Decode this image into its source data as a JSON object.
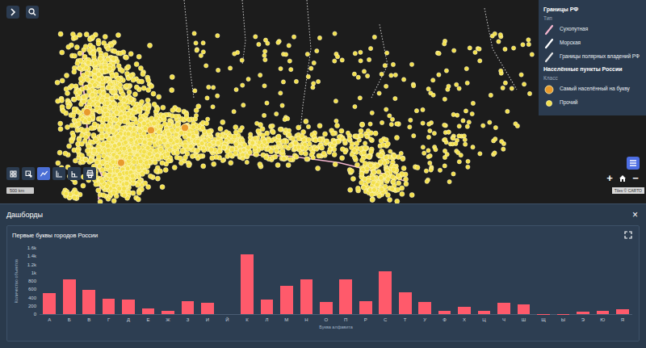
{
  "map": {
    "legend": {
      "title": "Границы РФ",
      "groups": [
        {
          "heading": "Тип",
          "items": [
            {
              "label": "Сухопутная",
              "kind": "line",
              "color": "#f4b6cf"
            },
            {
              "label": "Морская",
              "kind": "line",
              "color": "#ffffff"
            },
            {
              "label": "Границы полярных владений РФ",
              "kind": "line",
              "color": "#e6e6e6"
            }
          ]
        },
        {
          "title": "Населённые пункты России",
          "heading": "Класс",
          "items": [
            {
              "label": "Самый населённый на букву",
              "kind": "circle",
              "color": "#e89a2c"
            },
            {
              "label": "Прочий",
              "kind": "circle",
              "color": "#f3e04b"
            }
          ]
        }
      ]
    },
    "tools": [
      {
        "selected": false
      },
      {
        "selected": false
      },
      {
        "selected": true
      },
      {
        "selected": false
      },
      {
        "selected": false
      },
      {
        "selected": false
      }
    ],
    "scale": "500 km",
    "zoom": {
      "in": "+",
      "out": "−"
    },
    "attribution": "Tiles © CARTO"
  },
  "dashboard": {
    "title": "Дашборды",
    "close": "×",
    "chart": {
      "title": "Первые буквы городов России",
      "y_axis_title": "Количество объектов",
      "x_axis_title": "Буква алфавита",
      "y_ticks": [
        "0",
        "200",
        "400",
        "600",
        "800",
        "1k",
        "1.2k",
        "1.4k",
        "1.6k"
      ],
      "categories": [
        "А",
        "Б",
        "В",
        "Г",
        "Д",
        "Е",
        "Ж",
        "З",
        "И",
        "Й",
        "К",
        "Л",
        "М",
        "Н",
        "О",
        "П",
        "Р",
        "С",
        "Т",
        "У",
        "Ф",
        "Х",
        "Ц",
        "Ч",
        "Ш",
        "Щ",
        "Ы",
        "Э",
        "Ю",
        "Я"
      ],
      "series": [
        {
          "values": [
            500,
            830,
            590,
            370,
            350,
            130,
            70,
            310,
            270,
            0,
            1440,
            360,
            680,
            840,
            300,
            830,
            310,
            1040,
            520,
            300,
            80,
            170,
            70,
            270,
            230,
            10,
            5,
            60,
            70,
            120
          ]
        }
      ]
    }
  }
}
